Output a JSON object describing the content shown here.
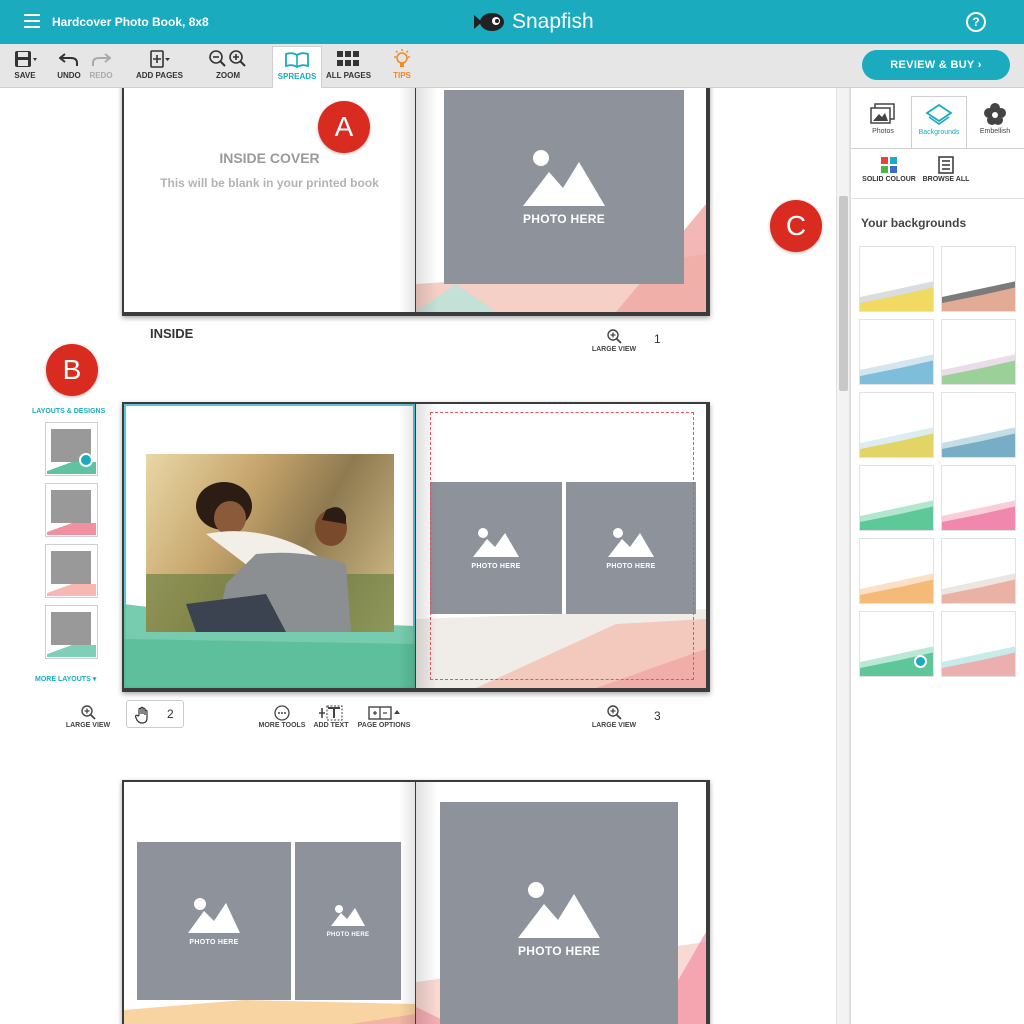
{
  "topbar": {
    "title": "Hardcover Photo Book, 8x8",
    "brand": "Snapfish",
    "help_glyph": "?"
  },
  "toolbar": {
    "save": "SAVE",
    "undo": "UNDO",
    "redo": "REDO",
    "add_pages": "ADD PAGES",
    "zoom": "ZOOM",
    "spreads": "SPREADS",
    "all_pages": "ALL PAGES",
    "tips": "TIPS",
    "review_buy": "REVIEW & BUY ›"
  },
  "canvas": {
    "spread1": {
      "inside_cover_title": "INSIDE COVER",
      "inside_cover_sub": "This will be blank in your printed book",
      "photo_label": "PHOTO HERE",
      "section_label": "INSIDE",
      "page_number": "1",
      "large_view": "LARGE VIEW"
    },
    "spread2": {
      "photo_label_a": "PHOTO HERE",
      "photo_label_b": "PHOTO HERE",
      "left_page_number": "2",
      "right_page_number": "3",
      "large_view_left": "LARGE VIEW",
      "large_view_right": "LARGE VIEW",
      "more_tools": "MORE TOOLS",
      "add_text": "ADD TEXT",
      "page_options": "PAGE OPTIONS"
    },
    "spread3": {
      "photo_label_a": "PHOTO HERE",
      "photo_label_b": "PHOTO HERE",
      "photo_label_c": "PHOTO HERE"
    },
    "badges": {
      "a": "A",
      "b": "B",
      "c": "C"
    }
  },
  "layouts": {
    "title": "LAYOUTS & DESIGNS",
    "more": "MORE LAYOUTS",
    "selected_index": 0
  },
  "panel": {
    "tabs": [
      "Photos",
      "Backgrounds",
      "Embellish"
    ],
    "active_tab": "Backgrounds",
    "solid_colour": "SOLID COLOUR",
    "browse_all": "BROWSE ALL",
    "heading": "Your backgrounds",
    "selected_background": 10
  },
  "colors": {
    "accent": "#1aabbf",
    "badge": "#d92b1f",
    "placeholder": "#8e939b"
  }
}
